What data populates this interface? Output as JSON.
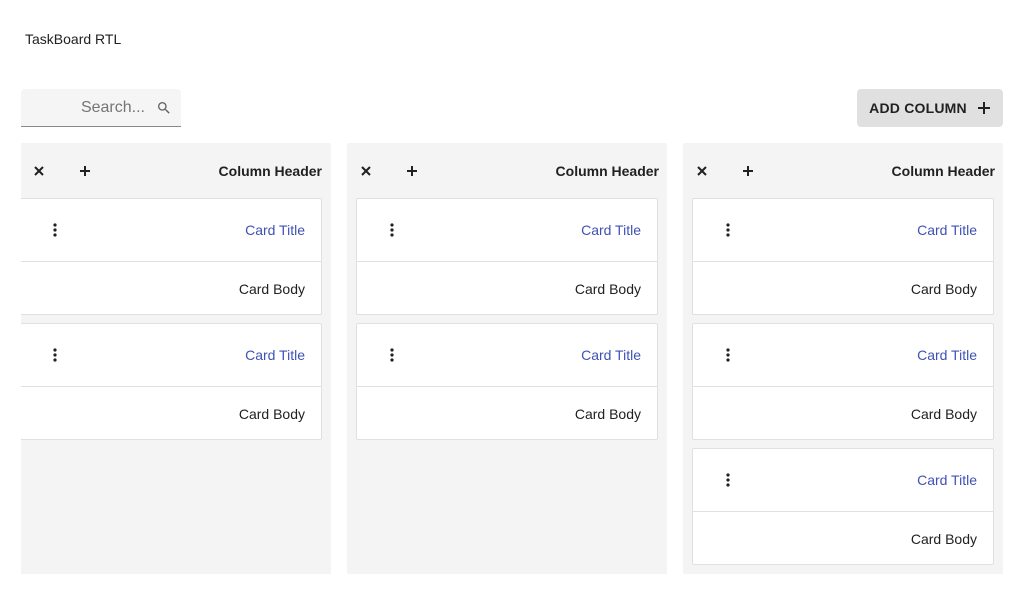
{
  "app": {
    "title": "TaskBoard RTL"
  },
  "search": {
    "placeholder": "...Search",
    "value": "",
    "icon": "search-icon"
  },
  "toolbar": {
    "add_column_label": "ADD COLUMN",
    "add_column_icon": "plus-icon"
  },
  "colors": {
    "accent": "#3f51b5",
    "column_bg": "#f4f4f4",
    "button_bg": "#e0e0e0"
  },
  "columns": [
    {
      "header": "Column Header",
      "cards": [
        {
          "title": "Card Title",
          "body": "Card Body"
        },
        {
          "title": "Card Title",
          "body": "Card Body"
        }
      ]
    },
    {
      "header": "Column Header",
      "cards": [
        {
          "title": "Card Title",
          "body": "Card Body"
        },
        {
          "title": "Card Title",
          "body": "Card Body"
        }
      ]
    },
    {
      "header": "Column Header",
      "cards": [
        {
          "title": "Card Title",
          "body": "Card Body"
        },
        {
          "title": "Card Title",
          "body": "Card Body"
        },
        {
          "title": "Card Title",
          "body": "Card Body"
        }
      ]
    }
  ]
}
